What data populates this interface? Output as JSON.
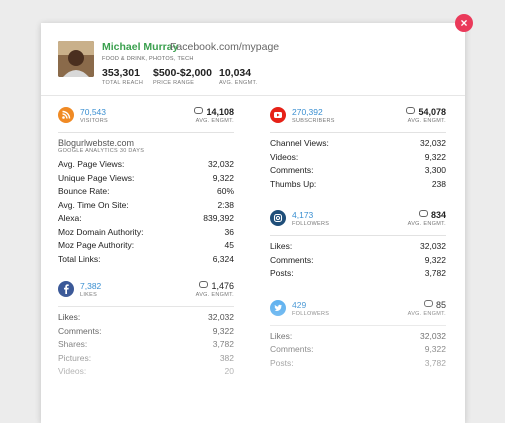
{
  "close_label": "×",
  "profile": {
    "name": "Michael Murray",
    "url": "Facebook.com/mypage",
    "categories": "FOOD & DRINK, PHOTOS, TECH",
    "stats": [
      {
        "value": "353,301",
        "label": "TOTAL REACH"
      },
      {
        "value": "$500-$2,000",
        "label": "PRICE RANGE"
      },
      {
        "value": "10,034",
        "label": "AVG. ENGMT."
      }
    ]
  },
  "colors": {
    "rss": "#f08a24",
    "youtube": "#e62117",
    "instagram": "#1f4e79",
    "facebook": "#3b5998",
    "twitter": "#55acee",
    "name": "#3aa04e",
    "link": "#3a8fd1",
    "close": "#ea3a5a"
  },
  "sections": {
    "blog": {
      "icon": "rss-icon",
      "count": "70,543",
      "count_label": "VISITORS",
      "engmt": "14,108",
      "engmt_label": "AVG. ENGMT.",
      "site": "Blogurlwebste.com",
      "site_sub": "GOOGLE ANALYTICS 30 DAYS",
      "rows": [
        {
          "label": "Avg. Page Views:",
          "value": "32,032"
        },
        {
          "label": "Unique Page Views:",
          "value": "9,322"
        },
        {
          "label": "Bounce Rate:",
          "value": "60%"
        },
        {
          "label": "Avg. Time On Site:",
          "value": "2:38"
        },
        {
          "label": "Alexa:",
          "value": "839,392"
        },
        {
          "label": "Moz Domain Authority:",
          "value": "36"
        },
        {
          "label": "Moz Page Authority:",
          "value": "45"
        },
        {
          "label": "Total Links:",
          "value": "6,324"
        }
      ]
    },
    "youtube": {
      "icon": "youtube-icon",
      "count": "270,392",
      "count_label": "SUBSCRIBERS",
      "engmt": "54,078",
      "engmt_label": "AVG. ENGMT.",
      "rows": [
        {
          "label": "Channel Views:",
          "value": "32,032"
        },
        {
          "label": "Videos:",
          "value": "9,322"
        },
        {
          "label": "Comments:",
          "value": "3,300"
        },
        {
          "label": "Thumbs Up:",
          "value": "238"
        }
      ]
    },
    "instagram": {
      "icon": "instagram-icon",
      "count": "4,173",
      "count_label": "FOLLOWERS",
      "engmt": "834",
      "engmt_label": "AVG. ENGMT.",
      "rows": [
        {
          "label": "Likes:",
          "value": "32,032"
        },
        {
          "label": "Comments:",
          "value": "9,322"
        },
        {
          "label": "Posts:",
          "value": "3,782"
        }
      ]
    },
    "facebook": {
      "icon": "facebook-icon",
      "count": "7,382",
      "count_label": "LIKES",
      "engmt": "1,476",
      "engmt_label": "AVG. ENGMT.",
      "rows": [
        {
          "label": "Likes:",
          "value": "32,032"
        },
        {
          "label": "Comments:",
          "value": "9,322"
        },
        {
          "label": "Shares:",
          "value": "3,782"
        },
        {
          "label": "Pictures:",
          "value": "382"
        },
        {
          "label": "Videos:",
          "value": "20"
        }
      ]
    },
    "twitter": {
      "icon": "twitter-icon",
      "count": "429",
      "count_label": "FOLLOWERS",
      "engmt": "85",
      "engmt_label": "AVG. ENGMT.",
      "rows": [
        {
          "label": "Likes:",
          "value": "32,032"
        },
        {
          "label": "Comments:",
          "value": "9,322"
        },
        {
          "label": "Posts:",
          "value": "3,782"
        }
      ]
    }
  }
}
